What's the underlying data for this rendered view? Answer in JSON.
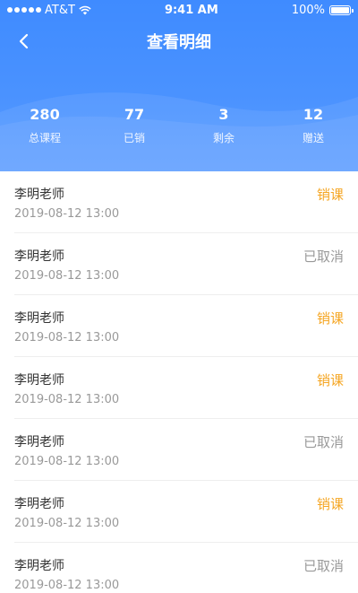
{
  "status_bar": {
    "carrier": "AT&T",
    "time": "9:41 AM",
    "battery": "100%"
  },
  "nav": {
    "title": "查看明细",
    "back_icon": "chevron-left-icon"
  },
  "stats": [
    {
      "value": "280",
      "label": "总课程"
    },
    {
      "value": "77",
      "label": "已销"
    },
    {
      "value": "3",
      "label": "剩余"
    },
    {
      "value": "12",
      "label": "赠送"
    }
  ],
  "records": [
    {
      "name": "李明老师",
      "time": "2019-08-12 13:00",
      "status": "销课",
      "type": "sold"
    },
    {
      "name": "李明老师",
      "time": "2019-08-12 13:00",
      "status": "已取消",
      "type": "cancel"
    },
    {
      "name": "李明老师",
      "time": "2019-08-12 13:00",
      "status": "销课",
      "type": "sold"
    },
    {
      "name": "李明老师",
      "time": "2019-08-12 13:00",
      "status": "销课",
      "type": "sold"
    },
    {
      "name": "李明老师",
      "time": "2019-08-12 13:00",
      "status": "已取消",
      "type": "cancel"
    },
    {
      "name": "李明老师",
      "time": "2019-08-12 13:00",
      "status": "销课",
      "type": "sold"
    },
    {
      "name": "李明老师",
      "time": "2019-08-12 13:00",
      "status": "已取消",
      "type": "cancel"
    }
  ],
  "colors": {
    "header_blue": "#4a92ff",
    "sold": "#f5a623",
    "cancel": "#999999"
  }
}
